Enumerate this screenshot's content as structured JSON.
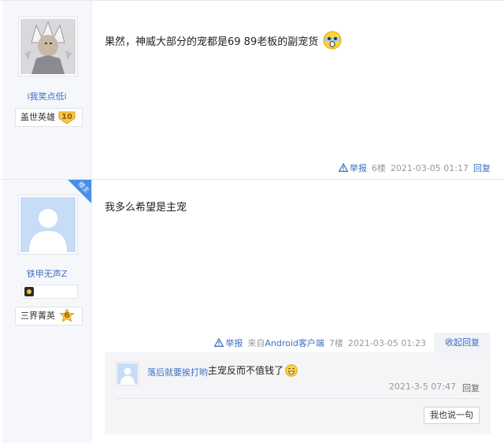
{
  "posts": [
    {
      "username": "i我笑点低i",
      "title": "盖世英雄",
      "level": "10",
      "content": "果然，神威大部分的宠都是69 89老板的副宠货",
      "report": "举报",
      "floor": "6楼",
      "time": "2021-03-05 01:17",
      "reply": "回复"
    },
    {
      "username": "铁甲无声Z",
      "badge": "楼主",
      "title": "三界菁英",
      "level": "6",
      "content": "我多么希望是主宠",
      "report": "举报",
      "source": "来自Android客户端",
      "floor": "7楼",
      "time": "2021-03-05 01:23",
      "fold_reply": "收起回复",
      "comments": [
        {
          "username": "落后就要挨打哟:",
          "text": "主宠反而不值钱了",
          "time": "2021-3-5 07:47",
          "reply": "回复"
        }
      ],
      "say_button": "我也说一句"
    }
  ],
  "colors": {
    "link": "#3d6fc1",
    "sidebar_bg": "#f5f7fb",
    "louzhu_badge": "#4a8ee6",
    "level_gold": "#f5c84c"
  },
  "icons": [
    "warning-triangle-icon",
    "surprised-emoji-icon",
    "grin-emoji-icon",
    "level-badge-icon",
    "medal-icon"
  ]
}
